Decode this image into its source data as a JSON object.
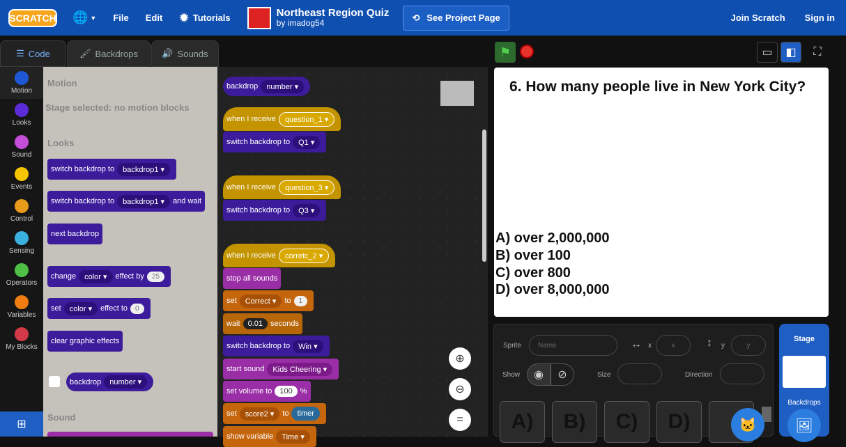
{
  "menubar": {
    "logo": "SCRATCH",
    "file": "File",
    "edit": "Edit",
    "tutorials": "Tutorials",
    "project_title": "Northeast Region Quiz",
    "project_by": "by imadog54",
    "see_project": "See Project Page",
    "join": "Join Scratch",
    "sign_in": "Sign in"
  },
  "tabs": {
    "code": "Code",
    "backdrops": "Backdrops",
    "sounds": "Sounds"
  },
  "categories": [
    {
      "label": "Motion",
      "color": "#1e58d6"
    },
    {
      "label": "Looks",
      "color": "#5a2bd6"
    },
    {
      "label": "Sound",
      "color": "#c54ed8"
    },
    {
      "label": "Events",
      "color": "#f5c400"
    },
    {
      "label": "Control",
      "color": "#e89a1a"
    },
    {
      "label": "Sensing",
      "color": "#3ab0e0"
    },
    {
      "label": "Operators",
      "color": "#4fbf45"
    },
    {
      "label": "Variables",
      "color": "#ef7d12"
    },
    {
      "label": "My Blocks",
      "color": "#d43a4a"
    }
  ],
  "palette": {
    "motion_heading": "Motion",
    "motion_note": "Stage selected: no motion blocks",
    "looks_heading": "Looks",
    "sound_heading": "Sound",
    "b1": "switch backdrop to",
    "b1_val": "backdrop1",
    "b2": "switch backdrop to",
    "b2_val": "backdrop1",
    "b2_tail": "and wait",
    "b3": "next backdrop",
    "b4": "change",
    "b4_val": "color",
    "b4_mid": "effect by",
    "b4_num": "25",
    "b5": "set",
    "b5_val": "color",
    "b5_mid": "effect to",
    "b5_num": "0",
    "b6": "clear graphic effects",
    "b7": "backdrop",
    "b7_val": "number"
  },
  "scripts": {
    "s0": "backdrop",
    "s0_val": "number",
    "h1": "when I receive",
    "h1_val": "question_1",
    "a1": "switch backdrop to",
    "a1_val": "Q1",
    "h2": "when I receive",
    "h2_val": "question_3",
    "a2": "switch backdrop to",
    "a2_val": "Q3",
    "h3": "when I receive",
    "h3_val": "corretc_2",
    "c1": "stop all sounds",
    "c2": "set",
    "c2_val": "Correct",
    "c2_mid": "to",
    "c2_num": "1",
    "c3": "wait",
    "c3_num": "0.01",
    "c3_tail": "seconds",
    "c4": "switch backdrop to",
    "c4_val": "Win",
    "c5": "start sound",
    "c5_val": "Kids Cheering",
    "c6": "set volume to",
    "c6_num": "100",
    "c6_tail": "%",
    "c7": "set",
    "c7_val": "score2",
    "c7_mid": "to",
    "c7_var": "timer",
    "c8": "show variable",
    "c8_val": "Time"
  },
  "stage": {
    "question": "6. How many people live in New York City?",
    "answers": [
      "A) over 2,000,000",
      "B) over 100",
      "C) over 800",
      "D) over 8,000,000"
    ]
  },
  "sprite_panel": {
    "sprite_label": "Sprite",
    "name_ph": "Name",
    "x_label": "x",
    "x_ph": "x",
    "y_label": "y",
    "y_ph": "y",
    "show_label": "Show",
    "size_label": "Size",
    "direction_label": "Direction",
    "tiles": [
      "A)",
      "B)",
      "C)",
      "D)"
    ]
  },
  "stage_pane": {
    "title": "Stage",
    "backdrops": "Backdrops"
  }
}
